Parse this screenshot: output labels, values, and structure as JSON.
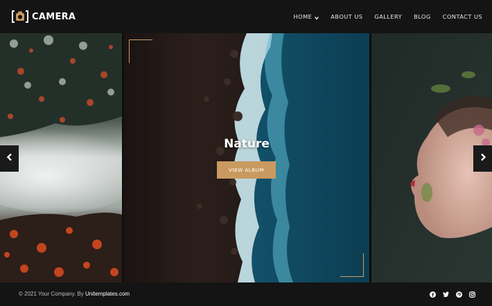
{
  "brand": {
    "name": "CAMERA",
    "icon": "camera-icon"
  },
  "nav": {
    "items": [
      {
        "label": "HOME",
        "has_dropdown": true
      },
      {
        "label": "ABOUT US"
      },
      {
        "label": "GALLERY"
      },
      {
        "label": "BLOG"
      },
      {
        "label": "CONTACT US"
      }
    ]
  },
  "slider": {
    "active_title": "Nature",
    "button_label": "VIEW ALBUM",
    "prev_icon": "chevron-left-icon",
    "next_icon": "chevron-right-icon",
    "accent_color": "#c99a5f"
  },
  "footer": {
    "copyright_prefix": "© 2021 Your Company. By ",
    "copyright_link": "Unitemplates.com",
    "socials": [
      "facebook-icon",
      "twitter-icon",
      "pinterest-icon",
      "instagram-icon"
    ]
  }
}
